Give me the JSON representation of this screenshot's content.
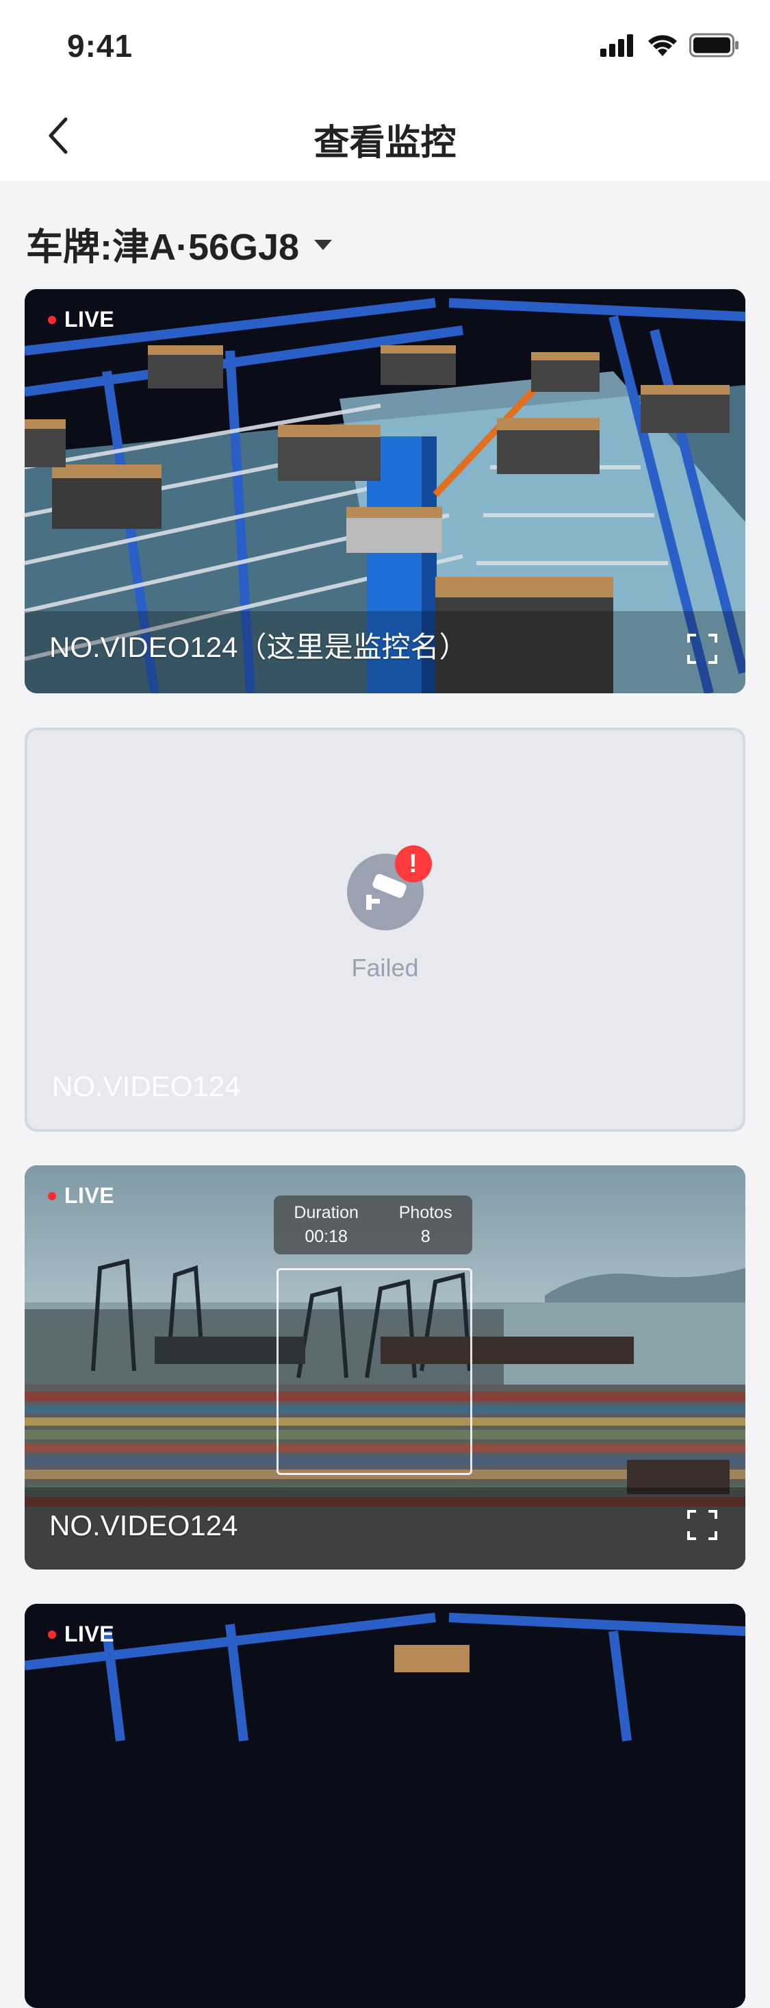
{
  "status": {
    "time": "9:41"
  },
  "nav": {
    "title": "查看监控"
  },
  "plate": {
    "text": "车牌:津A·56GJ8"
  },
  "cards": [
    {
      "live_label": "LIVE",
      "name": "NO.VIDEO124（这里是监控名）"
    },
    {
      "status_text": "Failed",
      "name": "NO.VIDEO124",
      "alert_mark": "!"
    },
    {
      "live_label": "LIVE",
      "name": "NO.VIDEO124",
      "overlay": {
        "duration_label": "Duration",
        "duration_value": "00:18",
        "photos_label": "Photos",
        "photos_value": "8"
      }
    },
    {
      "live_label": "LIVE"
    }
  ],
  "colors": {
    "live_dot": "#ff2b2b",
    "failed_badge": "#ff3b3b",
    "failed_icon": "#9aa1b1",
    "rack_blue": "#2a5fc8",
    "box_brown": "#b88a55"
  },
  "icons": [
    "back-chevron-icon",
    "signal-icon",
    "wifi-icon",
    "battery-icon",
    "dropdown-caret-icon",
    "fullscreen-icon",
    "camera-failed-icon"
  ]
}
